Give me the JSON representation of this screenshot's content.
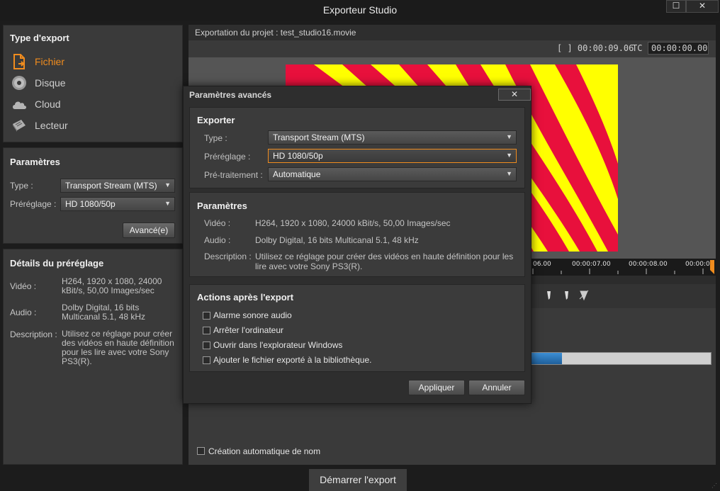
{
  "window": {
    "title": "Exporteur Studio",
    "maximize_glyph": "☐",
    "close_glyph": "✕"
  },
  "export_type": {
    "title": "Type d'export",
    "items": [
      {
        "label": "Fichier",
        "icon": "file-export-icon",
        "active": true
      },
      {
        "label": "Disque",
        "icon": "disc-icon",
        "active": false
      },
      {
        "label": "Cloud",
        "icon": "cloud-icon",
        "active": false
      },
      {
        "label": "Lecteur",
        "icon": "device-icon",
        "active": false
      }
    ]
  },
  "params": {
    "title": "Paramètres",
    "type_label": "Type :",
    "type_value": "Transport Stream (MTS)",
    "preset_label": "Préréglage :",
    "preset_value": "HD 1080/50p",
    "advanced_button": "Avancé(e)"
  },
  "preset_details": {
    "title": "Détails du préréglage",
    "video_label": "Vidéo :",
    "video_value": "H264, 1920 x 1080, 24000 kBit/s, 50,00 Images/sec",
    "audio_label": "Audio :",
    "audio_value": "Dolby Digital, 16 bits Multicanal 5.1, 48 kHz",
    "description_label": "Description :",
    "description_value": "Utilisez ce réglage pour créer des vidéos en haute définition pour les lire avec votre Sony PS3(R)."
  },
  "project": {
    "header": "Exportation du projet : test_studio16.movie",
    "duration": "[ ] 00:00:09.06",
    "tc_label": "TC",
    "tc_value": "00:00:00.00"
  },
  "timeline": {
    "labels": [
      "06.00",
      "00:00:07.00",
      "00:00:08.00",
      "00:00:0"
    ]
  },
  "export_progress": {
    "fraction": 0.2
  },
  "auto_name": {
    "label": "Création automatique de nom",
    "checked": false
  },
  "start_export_button": "Démarrer l'export",
  "advanced_dialog": {
    "title": "Paramètres avancés",
    "close_glyph": "✕",
    "export_section": {
      "title": "Exporter",
      "type_label": "Type :",
      "type_value": "Transport Stream (MTS)",
      "preset_label": "Préréglage :",
      "preset_value": "HD 1080/50p",
      "preprocess_label": "Pré-traitement :",
      "preprocess_value": "Automatique"
    },
    "params_section": {
      "title": "Paramètres",
      "video_label": "Vidéo :",
      "video_value": "H264, 1920 x 1080, 24000 kBit/s, 50,00 Images/sec",
      "audio_label": "Audio :",
      "audio_value": "Dolby Digital, 16 bits Multicanal 5.1, 48 kHz",
      "description_label": "Description :",
      "description_value": "Utilisez ce réglage pour créer des vidéos en haute définition pour les lire avec votre Sony PS3(R)."
    },
    "actions_section": {
      "title": "Actions après l'export",
      "options": [
        {
          "label": "Alarme sonore audio",
          "checked": false
        },
        {
          "label": "Arrêter l'ordinateur",
          "checked": false
        },
        {
          "label": "Ouvrir dans l'explorateur Windows",
          "checked": false
        },
        {
          "label": "Ajouter le fichier exporté à la bibliothèque.",
          "checked": false
        }
      ]
    },
    "apply_button": "Appliquer",
    "cancel_button": "Annuler"
  },
  "colors": {
    "accent": "#f08c1e",
    "preview_red": "#e8103c",
    "preview_yellow": "#ffff00",
    "progress": "#2f7fc4"
  }
}
